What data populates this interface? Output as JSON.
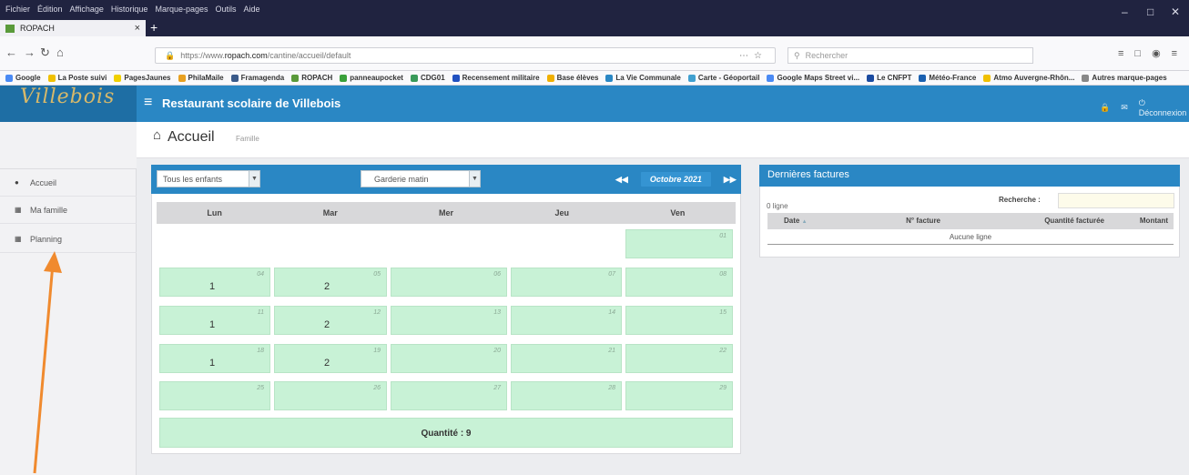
{
  "browser": {
    "menu": [
      "Fichier",
      "Édition",
      "Affichage",
      "Historique",
      "Marque-pages",
      "Outils",
      "Aide"
    ],
    "tab_title": "ROPACH",
    "url_prefix": "https://www.",
    "url_host": "ropach.com",
    "url_path": "/cantine/accueil/default",
    "search_placeholder": "Rechercher",
    "bookmarks": [
      "Google",
      "La Poste suivi",
      "PagesJaunes",
      "PhilaMaile",
      "Framagenda",
      "ROPACH",
      "panneaupocket",
      "CDG01",
      "Recensement militaire",
      "Base élèves",
      "La Vie Communale",
      "Carte - Géoportail",
      "Google Maps Street vi...",
      "Le CNFPT",
      "Météo-France",
      "Atmo Auvergne-Rhôn...",
      "Autres marque-pages"
    ]
  },
  "app": {
    "logo": "Villebois",
    "title": "Restaurant scolaire de Villebois",
    "logout": "Déconnexion",
    "page_title": "Accueil",
    "page_subtitle": "Famille"
  },
  "sidebar": {
    "items": [
      {
        "label": "Accueil",
        "icon": "dashboard-icon"
      },
      {
        "label": "Ma famille",
        "icon": "list-icon"
      },
      {
        "label": "Planning",
        "icon": "calendar-icon"
      }
    ]
  },
  "planning": {
    "child_select": "Tous les enfants",
    "meal_select": "Garderie matin",
    "month": "Octobre 2021",
    "days": [
      "Lun",
      "Mar",
      "Mer",
      "Jeu",
      "Ven"
    ],
    "week0": [
      {
        "d": "01",
        "n": ""
      }
    ],
    "weeks": [
      [
        {
          "d": "04",
          "n": "1"
        },
        {
          "d": "05",
          "n": "2"
        },
        {
          "d": "06",
          "n": ""
        },
        {
          "d": "07",
          "n": ""
        },
        {
          "d": "08",
          "n": ""
        }
      ],
      [
        {
          "d": "11",
          "n": "1"
        },
        {
          "d": "12",
          "n": "2"
        },
        {
          "d": "13",
          "n": ""
        },
        {
          "d": "14",
          "n": ""
        },
        {
          "d": "15",
          "n": ""
        }
      ],
      [
        {
          "d": "18",
          "n": "1"
        },
        {
          "d": "19",
          "n": "2"
        },
        {
          "d": "20",
          "n": ""
        },
        {
          "d": "21",
          "n": ""
        },
        {
          "d": "22",
          "n": ""
        }
      ],
      [
        {
          "d": "25",
          "n": ""
        },
        {
          "d": "26",
          "n": ""
        },
        {
          "d": "27",
          "n": ""
        },
        {
          "d": "28",
          "n": ""
        },
        {
          "d": "29",
          "n": ""
        }
      ]
    ],
    "quantity": "Quantité : 9"
  },
  "invoices": {
    "title": "Dernières factures",
    "count": "0 ligne",
    "search_label": "Recherche :",
    "columns": [
      "Date",
      "N° facture",
      "Quantité facturée",
      "Montant"
    ],
    "empty": "Aucune ligne"
  },
  "colors": {
    "header": "#2a87c4",
    "cell": "#c8f2d6",
    "arrow": "#f08a2e"
  }
}
